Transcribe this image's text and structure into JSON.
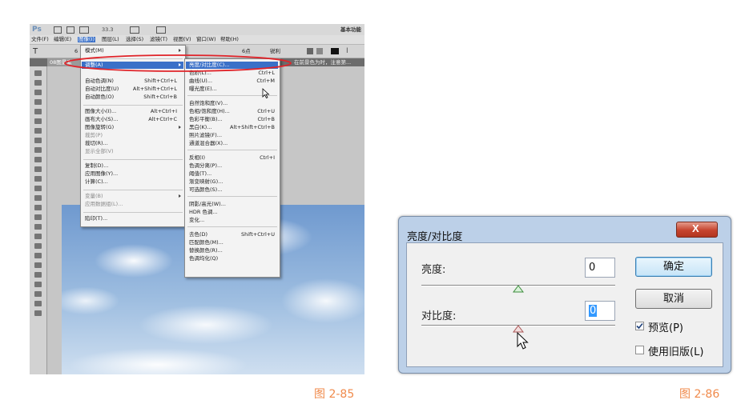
{
  "ps": {
    "app_logo": "Ps",
    "zoom": "33.3",
    "workspace": "基本功能",
    "menubar": [
      "文件(F)",
      "编辑(E)",
      "图像(I)",
      "图层(L)",
      "选择(S)",
      "滤镜(T)",
      "视图(V)",
      "窗口(W)",
      "帮助(H)"
    ],
    "options": {
      "size_value": "6",
      "font_size": "6点",
      "style_value": "锐利"
    },
    "doc_tab": "08图景素",
    "info_text": "在前景色为时，注意第...",
    "image_menu": [
      {
        "label": "模式(M)",
        "shortcut": ""
      },
      {
        "label": "调整(A)",
        "shortcut": ""
      },
      {
        "label": "自动色调(N)",
        "shortcut": "Shift+Ctrl+L"
      },
      {
        "label": "自动对比度(U)",
        "shortcut": "Alt+Shift+Ctrl+L"
      },
      {
        "label": "自动颜色(O)",
        "shortcut": "Shift+Ctrl+B"
      },
      {
        "label": "图像大小(I)...",
        "shortcut": "Alt+Ctrl+I"
      },
      {
        "label": "画布大小(S)...",
        "shortcut": "Alt+Ctrl+C"
      },
      {
        "label": "图像旋转(G)",
        "shortcut": ""
      },
      {
        "label": "裁剪(P)",
        "shortcut": ""
      },
      {
        "label": "裁切(R)...",
        "shortcut": ""
      },
      {
        "label": "显示全部(V)",
        "shortcut": ""
      },
      {
        "label": "复制(D)...",
        "shortcut": ""
      },
      {
        "label": "应用图像(Y)...",
        "shortcut": ""
      },
      {
        "label": "计算(C)...",
        "shortcut": ""
      },
      {
        "label": "变量(B)",
        "shortcut": ""
      },
      {
        "label": "应用数据组(L)...",
        "shortcut": ""
      },
      {
        "label": "陷印(T)...",
        "shortcut": ""
      }
    ],
    "adjust_menu": [
      {
        "label": "亮度/对比度(C)...",
        "shortcut": ""
      },
      {
        "label": "色阶(L)...",
        "shortcut": "Ctrl+L"
      },
      {
        "label": "曲线(U)...",
        "shortcut": "Ctrl+M"
      },
      {
        "label": "曝光度(E)...",
        "shortcut": ""
      },
      {
        "label": "自然饱和度(V)...",
        "shortcut": ""
      },
      {
        "label": "色相/饱和度(H)...",
        "shortcut": "Ctrl+U"
      },
      {
        "label": "色彩平衡(B)...",
        "shortcut": "Ctrl+B"
      },
      {
        "label": "黑白(K)...",
        "shortcut": "Alt+Shift+Ctrl+B"
      },
      {
        "label": "照片滤镜(F)...",
        "shortcut": ""
      },
      {
        "label": "通道混合器(X)...",
        "shortcut": ""
      },
      {
        "label": "反相(I)",
        "shortcut": "Ctrl+I"
      },
      {
        "label": "色调分离(P)...",
        "shortcut": ""
      },
      {
        "label": "阈值(T)...",
        "shortcut": ""
      },
      {
        "label": "渐变映射(G)...",
        "shortcut": ""
      },
      {
        "label": "可选颜色(S)...",
        "shortcut": ""
      },
      {
        "label": "阴影/高光(W)...",
        "shortcut": ""
      },
      {
        "label": "HDR 色调...",
        "shortcut": ""
      },
      {
        "label": "变化...",
        "shortcut": ""
      },
      {
        "label": "去色(D)",
        "shortcut": "Shift+Ctrl+U"
      },
      {
        "label": "匹配颜色(M)...",
        "shortcut": ""
      },
      {
        "label": "替换颜色(R)...",
        "shortcut": ""
      },
      {
        "label": "色调均化(Q)",
        "shortcut": ""
      }
    ]
  },
  "dialog": {
    "title": "亮度/对比度",
    "close_glyph": "X",
    "brightness_label": "亮度:",
    "brightness_value": "0",
    "contrast_label": "对比度:",
    "contrast_value": "0",
    "ok_label": "确定",
    "cancel_label": "取消",
    "preview_label": "预览(P)",
    "preview_checked": true,
    "legacy_label": "使用旧版(L)",
    "legacy_checked": false,
    "brightness_slider": 0.5,
    "contrast_slider": 0.5
  },
  "captions": {
    "left": "图 2-85",
    "right": "图 2-86"
  },
  "colors": {
    "highlight_ellipse": "#e0242a",
    "caption": "#f08a4b",
    "selected_item": "#3a70c8"
  },
  "icons": [
    "tool-icons",
    "checkmark-icon",
    "close-icon",
    "cursor-arrow-icon"
  ]
}
